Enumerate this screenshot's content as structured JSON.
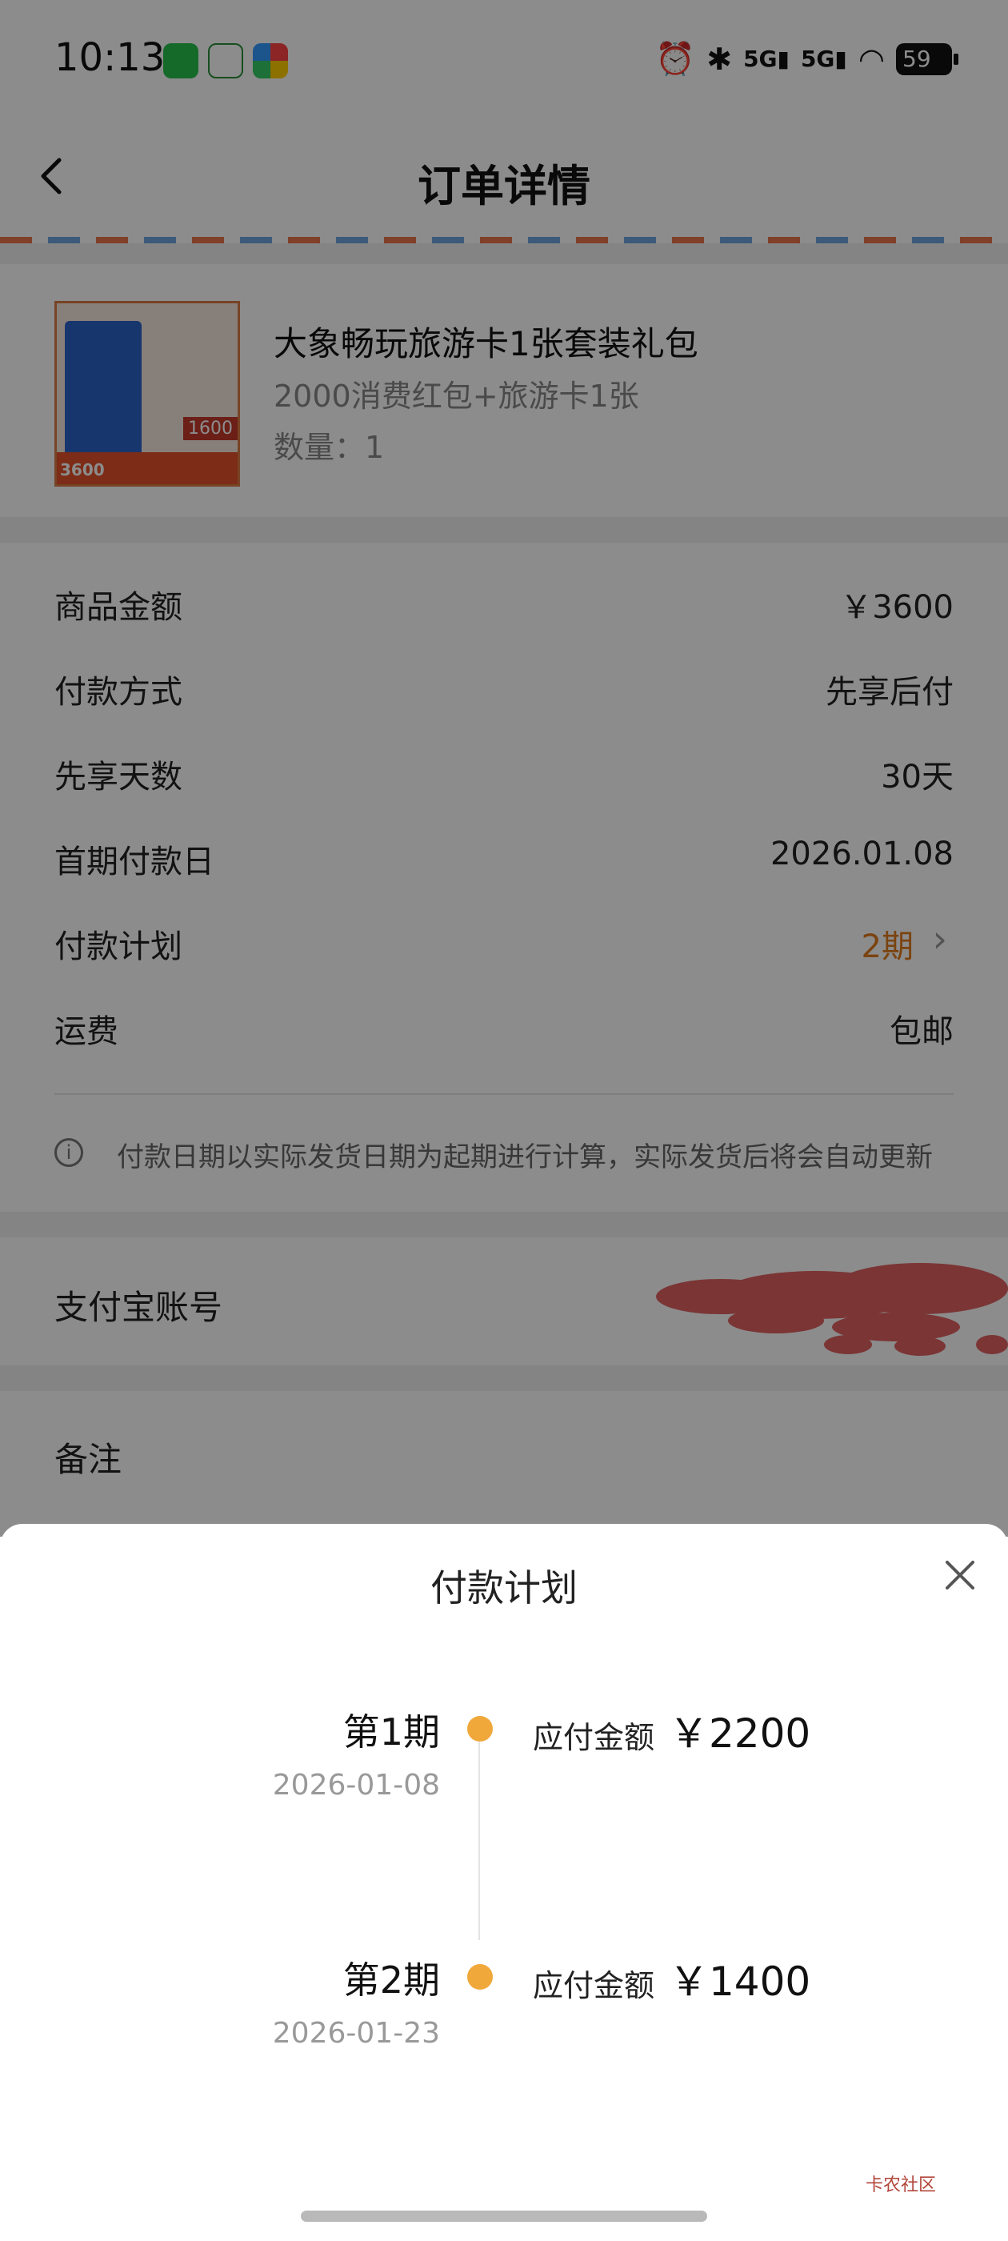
{
  "status_bar": {
    "time": "10:13",
    "battery": "59"
  },
  "nav": {
    "title": "订单详情"
  },
  "product": {
    "name": "大象畅玩旅游卡1张套装礼包",
    "desc": "2000消费红包+旅游卡1张",
    "qty": "数量：1",
    "thumb_price": "1600",
    "thumb_caption": "3600"
  },
  "details": {
    "rows": [
      {
        "label": "商品金额",
        "value": "￥3600"
      },
      {
        "label": "付款方式",
        "value": "先享后付"
      },
      {
        "label": "先享天数",
        "value": "30天"
      },
      {
        "label": "首期付款日",
        "value": "2026.01.08"
      },
      {
        "label": "付款计划",
        "value": "2期"
      },
      {
        "label": "运费",
        "value": "包邮"
      }
    ],
    "notice": "付款日期以实际发货日期为起期进行计算，实际发货后将会自动更新"
  },
  "alipay": {
    "label": "支付宝账号"
  },
  "remark": {
    "label": "备注"
  },
  "sheet": {
    "title": "付款计划",
    "installments": [
      {
        "period": "第1期",
        "date": "2026-01-08",
        "due_label": "应付金额",
        "amount": "￥2200"
      },
      {
        "period": "第2期",
        "date": "2026-01-23",
        "due_label": "应付金额",
        "amount": "￥1400"
      }
    ]
  },
  "watermark": "卡农社区",
  "colors": {
    "accent": "#f0a83a",
    "orange_text": "#e07a1c",
    "redact": "#e06262"
  }
}
